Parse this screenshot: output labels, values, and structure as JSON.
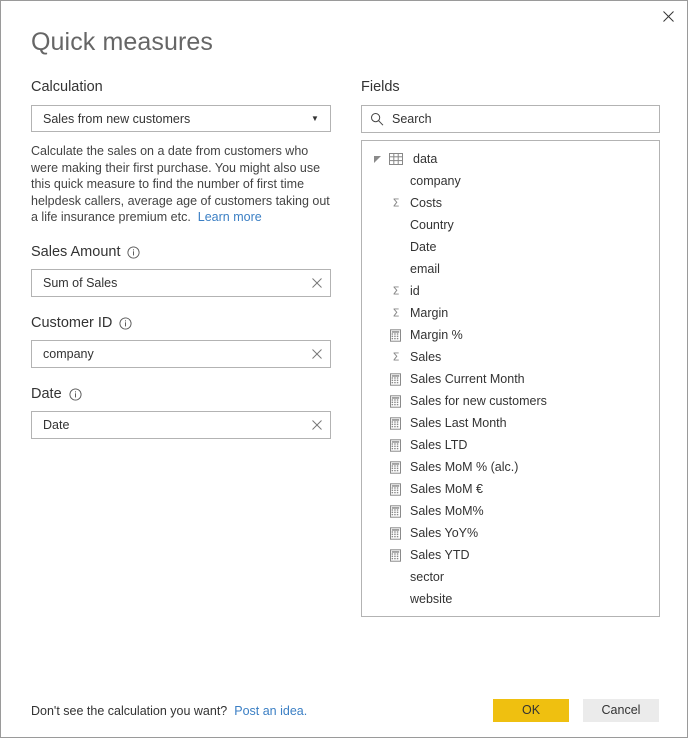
{
  "dialog": {
    "title": "Quick measures",
    "close_label": "Close"
  },
  "calculation": {
    "section_label": "Calculation",
    "selected": "Sales from new customers",
    "caret_icon": "chevron-down-icon",
    "description": "Calculate the sales on a date from customers who were making their first purchase. You might also use this quick measure to find the number of first time helpdesk callers, average age of customers taking out a life insurance premium etc.",
    "learn_more": "Learn more"
  },
  "fields_inputs": [
    {
      "label": "Sales Amount",
      "info_icon": "info-icon",
      "value": "Sum of Sales",
      "clear_icon": "close-icon"
    },
    {
      "label": "Customer ID",
      "info_icon": "info-icon",
      "value": "company",
      "clear_icon": "close-icon"
    },
    {
      "label": "Date",
      "info_icon": "info-icon",
      "value": "Date",
      "clear_icon": "close-icon"
    }
  ],
  "fields_panel": {
    "section_label": "Fields",
    "search": {
      "icon": "search-icon",
      "placeholder": "Search",
      "value": ""
    },
    "table": {
      "name": "data",
      "icon": "table-icon",
      "caret_icon": "expanded-triangle-icon",
      "expanded": true
    },
    "items": [
      {
        "label": "company",
        "icon": "none"
      },
      {
        "label": "Costs",
        "icon": "sigma-icon"
      },
      {
        "label": "Country",
        "icon": "none"
      },
      {
        "label": "Date",
        "icon": "none"
      },
      {
        "label": "email",
        "icon": "none"
      },
      {
        "label": "id",
        "icon": "sigma-icon"
      },
      {
        "label": "Margin",
        "icon": "sigma-icon"
      },
      {
        "label": "Margin %",
        "icon": "measure-icon"
      },
      {
        "label": "Sales",
        "icon": "sigma-icon"
      },
      {
        "label": "Sales Current Month",
        "icon": "measure-icon"
      },
      {
        "label": "Sales for new customers",
        "icon": "measure-icon"
      },
      {
        "label": "Sales Last Month",
        "icon": "measure-icon"
      },
      {
        "label": "Sales LTD",
        "icon": "measure-icon"
      },
      {
        "label": "Sales MoM % (alc.)",
        "icon": "measure-icon"
      },
      {
        "label": "Sales MoM €",
        "icon": "measure-icon"
      },
      {
        "label": "Sales MoM%",
        "icon": "measure-icon"
      },
      {
        "label": "Sales YoY%",
        "icon": "measure-icon"
      },
      {
        "label": "Sales YTD",
        "icon": "measure-icon"
      },
      {
        "label": "sector",
        "icon": "none"
      },
      {
        "label": "website",
        "icon": "none"
      }
    ]
  },
  "footer": {
    "note": "Don't see the calculation you want?",
    "note_link": "Post an idea.",
    "ok_label": "OK",
    "cancel_label": "Cancel"
  },
  "colors": {
    "accent_yellow": "#efc010",
    "link_blue": "#3b7fc4",
    "border_gray": "#b3b3b3",
    "text": "#333333"
  }
}
